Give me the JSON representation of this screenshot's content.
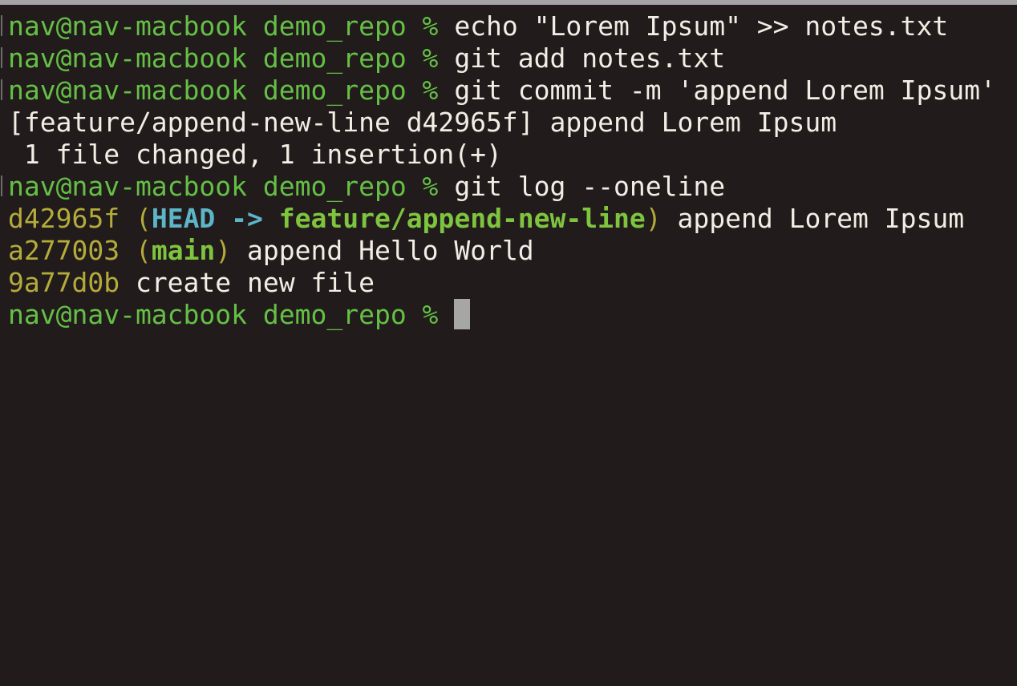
{
  "prompt": "nav@nav-macbook demo_repo %",
  "commands": [
    "echo \"Lorem Ipsum\" >> notes.txt",
    "git add notes.txt",
    "git commit -m 'append Lorem Ipsum'",
    "git log --oneline"
  ],
  "commit_output": {
    "summary": "[feature/append-new-line d42965f] append Lorem Ipsum",
    "stats": " 1 file changed, 1 insertion(+)"
  },
  "log": [
    {
      "hash": "d42965f",
      "open_paren": "(",
      "head": "HEAD",
      "arrow": " -> ",
      "branch": "feature/append-new-line",
      "close_paren": ")",
      "message": " append Lorem Ipsum"
    },
    {
      "hash": "a277003",
      "open_paren": "(",
      "branch": "main",
      "close_paren": ")",
      "message": " append Hello World"
    },
    {
      "hash": "9a77d0b",
      "message": " create new file"
    }
  ],
  "colors": {
    "background": "#221b1c",
    "prompt": "#64c045",
    "hash": "#b4ac3a",
    "head": "#5cb6c7",
    "branch": "#7ec43f",
    "text": "#f2eee4",
    "cursor": "#a6a6a6"
  }
}
